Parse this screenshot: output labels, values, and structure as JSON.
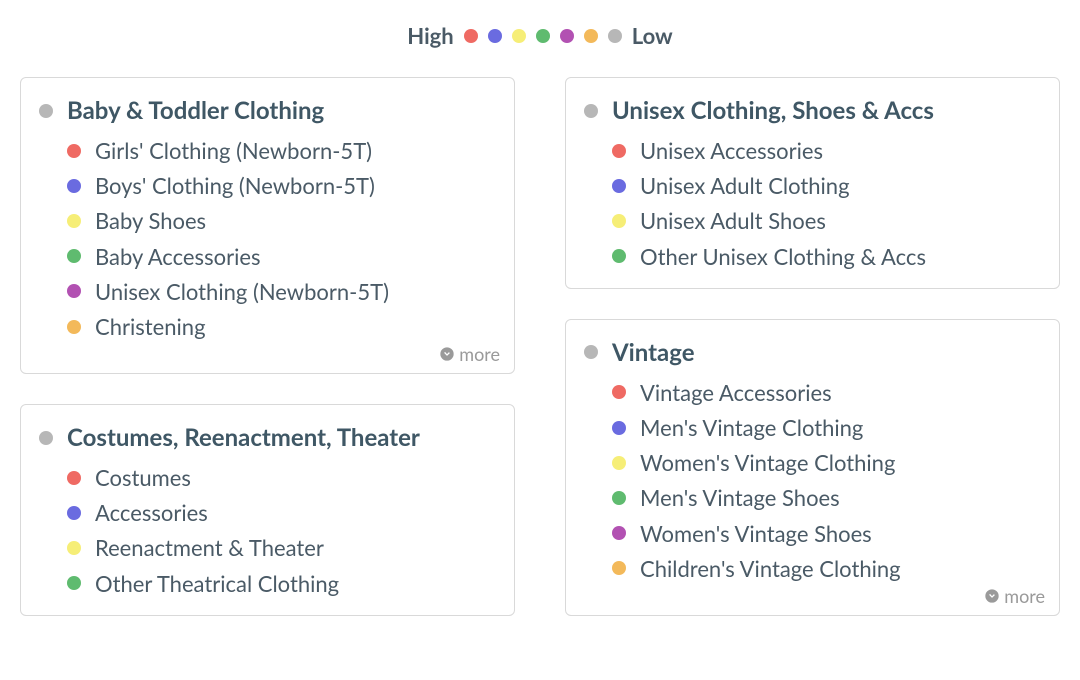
{
  "colors": {
    "red": "#ef6a63",
    "blue": "#6a6be0",
    "yellow": "#f6ee77",
    "green": "#5fbb6f",
    "purple": "#b251b2",
    "orange": "#f3b95a",
    "grey": "#b7b7b7"
  },
  "legend": {
    "high_label": "High",
    "low_label": "Low",
    "order": [
      "red",
      "blue",
      "yellow",
      "green",
      "purple",
      "orange",
      "grey"
    ]
  },
  "more_label": "more",
  "columns": [
    [
      {
        "id": "baby-toddler",
        "title": "Baby & Toddler Clothing",
        "has_more": true,
        "clip": true,
        "items": [
          {
            "color": "red",
            "label": "Girls' Clothing (Newborn-5T)"
          },
          {
            "color": "blue",
            "label": "Boys' Clothing (Newborn-5T)"
          },
          {
            "color": "yellow",
            "label": "Baby Shoes"
          },
          {
            "color": "green",
            "label": "Baby Accessories"
          },
          {
            "color": "purple",
            "label": "Unisex Clothing (Newborn-5T)"
          },
          {
            "color": "orange",
            "label": "Christening"
          }
        ]
      },
      {
        "id": "costumes",
        "title": "Costumes, Reenactment, Theater",
        "has_more": false,
        "clip": false,
        "items": [
          {
            "color": "red",
            "label": "Costumes"
          },
          {
            "color": "blue",
            "label": "Accessories"
          },
          {
            "color": "yellow",
            "label": "Reenactment & Theater"
          },
          {
            "color": "green",
            "label": "Other Theatrical Clothing"
          }
        ]
      }
    ],
    [
      {
        "id": "unisex",
        "title": "Unisex Clothing, Shoes & Accs",
        "has_more": false,
        "clip": false,
        "items": [
          {
            "color": "red",
            "label": "Unisex Accessories"
          },
          {
            "color": "blue",
            "label": "Unisex Adult Clothing"
          },
          {
            "color": "yellow",
            "label": "Unisex Adult Shoes"
          },
          {
            "color": "green",
            "label": "Other Unisex Clothing & Accs"
          }
        ]
      },
      {
        "id": "vintage",
        "title": "Vintage",
        "has_more": true,
        "clip": true,
        "items": [
          {
            "color": "red",
            "label": "Vintage Accessories"
          },
          {
            "color": "blue",
            "label": "Men's Vintage Clothing"
          },
          {
            "color": "yellow",
            "label": "Women's Vintage Clothing"
          },
          {
            "color": "green",
            "label": "Men's Vintage Shoes"
          },
          {
            "color": "purple",
            "label": "Women's Vintage Shoes"
          },
          {
            "color": "orange",
            "label": "Children's Vintage Clothing"
          }
        ]
      }
    ]
  ]
}
